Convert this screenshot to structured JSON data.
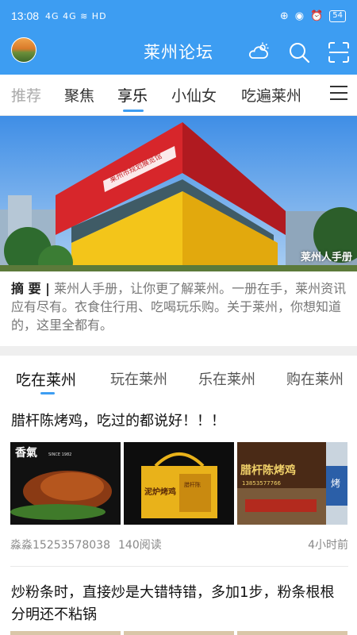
{
  "status_bar": {
    "time": "13:08",
    "signals": "4G 4G ≋ HD",
    "battery": "54"
  },
  "app": {
    "title": "莱州论坛"
  },
  "icons": {
    "weather": "weather-icon",
    "search": "search-icon",
    "scan": "scan-icon",
    "menu": "menu-icon"
  },
  "tabs": [
    {
      "label": "推荐"
    },
    {
      "label": "聚焦"
    },
    {
      "label": "享乐"
    },
    {
      "label": "小仙女"
    },
    {
      "label": "吃遍莱州"
    }
  ],
  "banner": {
    "caption": "莱州人手册",
    "building_sign": "莱州市规划展览馆"
  },
  "summary": {
    "label": "摘 要 |",
    "text": " 莱州人手册，让你更了解莱州。一册在手，莱州资讯应有尽有。衣食住行用、吃喝玩乐购。关于莱州，你想知道的，这里全都有。"
  },
  "subtabs": [
    {
      "label": "吃在莱州"
    },
    {
      "label": "玩在莱州"
    },
    {
      "label": "乐在莱州"
    },
    {
      "label": "购在莱州"
    }
  ],
  "posts": [
    {
      "title": "腊杆陈烤鸡，吃过的都说好！！！",
      "author": "淼淼15253578038",
      "reads": "140阅读",
      "time": "4小时前",
      "images": [
        {
          "text": "香氣",
          "sub": "SINCE 1982"
        },
        {
          "text": "泥炉烤鸡",
          "sub": "腊杆陈"
        },
        {
          "text": "腊杆陈烤鸡",
          "sub": "13853577766",
          "side": "烤"
        }
      ]
    },
    {
      "title": "炒粉条时，直接炒是大错特错，多加1步，粉条根根分明还不粘锅"
    }
  ],
  "colors": {
    "accent": "#3d9df2",
    "text": "#111111",
    "muted": "#888888"
  }
}
